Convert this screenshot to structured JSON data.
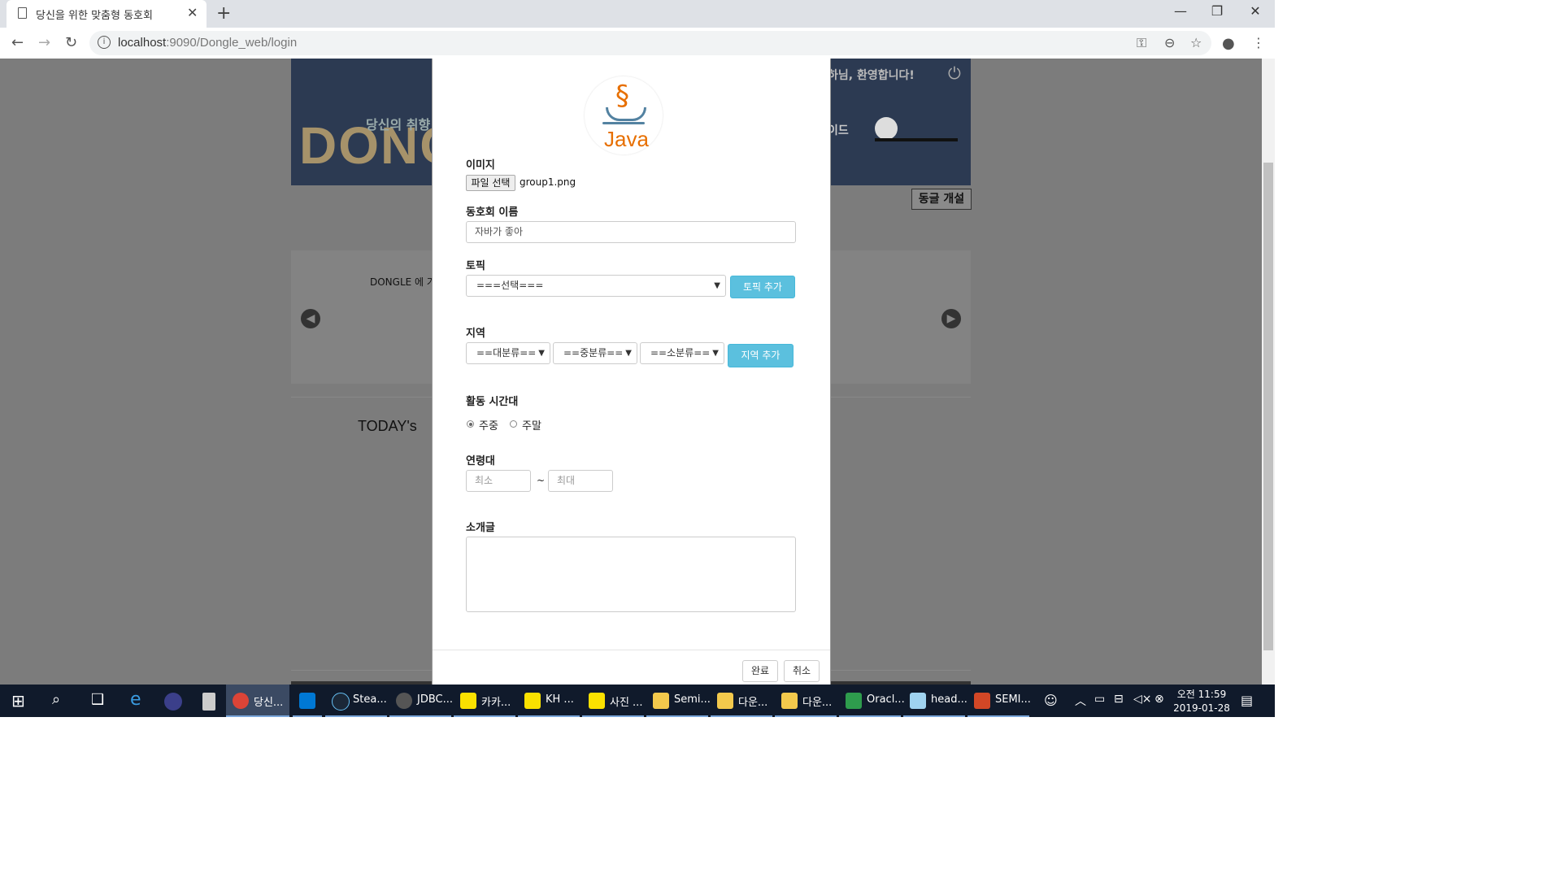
{
  "browser": {
    "tab_title": "당신을 위한 맞춤형 동호회",
    "tab_close": "✕",
    "new_tab": "+",
    "url_host": "localhost",
    "url_rest": ":9090/Dongle_web/login",
    "minimize": "—",
    "maximize": "❐",
    "close": "✕",
    "back": "←",
    "forward": "→",
    "reload": "↻"
  },
  "background_page": {
    "banner_logo": "DONG",
    "banner_tagline": "당신의 취향",
    "banner_welcome": "하님, 환영합니다!",
    "banner_guide": "이드",
    "open_club_button": "동글 개설",
    "carousel_caption": "DONGLE 에 가",
    "today_title": "TODAY's"
  },
  "modal": {
    "logo_text": "Java",
    "image_label": "이미지",
    "file_button": "파일 선택",
    "file_name": "group1.png",
    "club_name_label": "동호회 이름",
    "club_name_value": "자바가 좋아",
    "topic_label": "토픽",
    "topic_select": "===선택===",
    "topic_add_button": "토픽 추가",
    "region_label": "지역",
    "region_large": "==대분류==",
    "region_medium": "==중분류==",
    "region_small": "==소분류==",
    "region_add_button": "지역 추가",
    "activity_label": "활동 시간대",
    "weekday": "주중",
    "weekend": "주말",
    "age_label": "연령대",
    "age_min_placeholder": "최소",
    "age_separator": "~",
    "age_max_placeholder": "최대",
    "intro_label": "소개글",
    "done_button": "완료",
    "cancel_button": "취소"
  },
  "taskbar": {
    "items": [
      "당신...",
      "Stea...",
      "JDBC...",
      "카카...",
      "KH ...",
      "사진 ...",
      "Semi...",
      "다운...",
      "다운...",
      "Oracl...",
      "head...",
      "SEMI..."
    ],
    "time": "오전 11:59",
    "date": "2019-01-28"
  },
  "colors": {
    "accent_blue": "#5bc0de",
    "java_orange": "#e76f00",
    "java_blue": "#5382a1",
    "taskbar": "#101a2b"
  }
}
